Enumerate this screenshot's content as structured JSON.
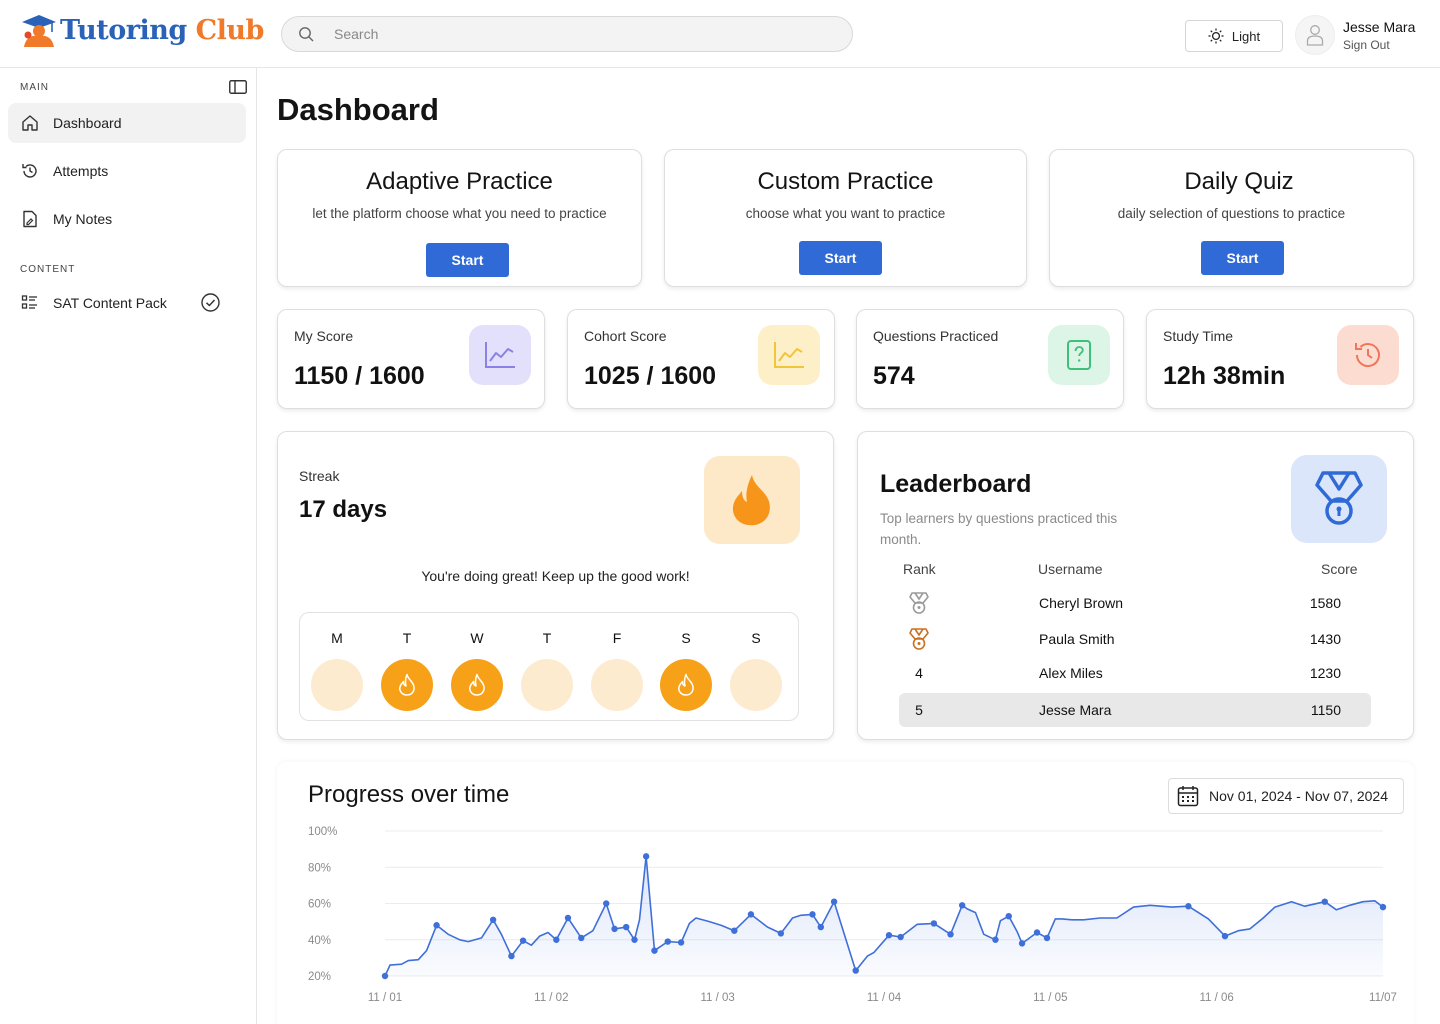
{
  "header": {
    "logo_part1": "Tutoring",
    "logo_part2": "Club",
    "search_placeholder": "Search",
    "theme_label": "Light",
    "user_name": "Jesse Mara",
    "sign_out": "Sign Out"
  },
  "sidebar": {
    "section_main": "MAIN",
    "section_content": "CONTENT",
    "items": [
      {
        "label": "Dashboard",
        "icon": "home-icon"
      },
      {
        "label": "Attempts",
        "icon": "history-icon"
      },
      {
        "label": "My Notes",
        "icon": "notes-icon"
      }
    ],
    "content_items": [
      {
        "label": "SAT Content Pack",
        "icon": "list-icon"
      }
    ]
  },
  "page": {
    "title": "Dashboard"
  },
  "practice": [
    {
      "title": "Adaptive Practice",
      "desc": "let the platform choose what you need to practice",
      "button": "Start"
    },
    {
      "title": "Custom Practice",
      "desc": "choose what you want to practice",
      "button": "Start"
    },
    {
      "title": "Daily Quiz",
      "desc": "daily selection of questions to practice",
      "button": "Start"
    }
  ],
  "stats": [
    {
      "label": "My Score",
      "value": "1150 / 1600",
      "icon": "line-chart-icon",
      "color": "#e3e0fb"
    },
    {
      "label": "Cohort Score",
      "value": "1025 / 1600",
      "icon": "line-chart-icon",
      "color": "#fdf0c8"
    },
    {
      "label": "Questions Practiced",
      "value": "574",
      "icon": "question-card-icon",
      "color": "#dcf5e6"
    },
    {
      "label": "Study Time",
      "value": "12h 38min",
      "icon": "clock-history-icon",
      "color": "#fcdcd1"
    }
  ],
  "streak": {
    "label": "Streak",
    "value": "17 days",
    "message": "You're doing great! Keep up the good work!",
    "days": [
      {
        "letter": "M",
        "active": false
      },
      {
        "letter": "T",
        "active": true
      },
      {
        "letter": "W",
        "active": true
      },
      {
        "letter": "T",
        "active": false
      },
      {
        "letter": "F",
        "active": false
      },
      {
        "letter": "S",
        "active": true
      },
      {
        "letter": "S",
        "active": false
      }
    ]
  },
  "leaderboard": {
    "title": "Leaderboard",
    "subtitle": "Top learners by questions practiced this month.",
    "col_rank": "Rank",
    "col_user": "Username",
    "col_score": "Score",
    "rows": [
      {
        "rank": "",
        "medal": "silver",
        "user": "Cheryl Brown",
        "score": "1580"
      },
      {
        "rank": "",
        "medal": "bronze",
        "user": "Paula Smith",
        "score": "1430"
      },
      {
        "rank": "4",
        "medal": "",
        "user": "Alex Miles",
        "score": "1230"
      },
      {
        "rank": "5",
        "medal": "",
        "user": "Jesse Mara",
        "score": "1150"
      }
    ]
  },
  "progress": {
    "title": "Progress over time",
    "date_range": "Nov 01, 2024 - Nov 07, 2024"
  },
  "chart_data": {
    "type": "area",
    "title": "Progress over time",
    "ylim": [
      20,
      100
    ],
    "yticks": [
      "100%",
      "80%",
      "60%",
      "40%",
      "20%"
    ],
    "ytick_values": [
      100,
      80,
      60,
      40,
      20
    ],
    "xticks": [
      "11 / 01",
      "11 / 02",
      "11 / 03",
      "11 / 04",
      "11 / 05",
      "11 / 06",
      "11/07"
    ],
    "xlim": [
      0,
      6
    ],
    "grid": true,
    "series": [
      {
        "color": "#3f6fd8",
        "x": [
          0.0,
          0.03,
          0.1,
          0.14,
          0.2,
          0.25,
          0.31,
          0.38,
          0.45,
          0.5,
          0.58,
          0.65,
          0.7,
          0.76,
          0.83,
          0.88,
          0.93,
          0.98,
          1.03,
          1.1,
          1.18,
          1.25,
          1.33,
          1.38,
          1.45,
          1.5,
          1.53,
          1.57,
          1.62,
          1.7,
          1.78,
          1.83,
          1.87,
          1.95,
          2.02,
          2.1,
          2.2,
          2.3,
          2.38,
          2.45,
          2.5,
          2.57,
          2.62,
          2.7,
          2.83,
          2.9,
          2.94,
          3.03,
          3.1,
          3.2,
          3.3,
          3.4,
          3.47,
          3.5,
          3.55,
          3.6,
          3.67,
          3.7,
          3.75,
          3.8,
          3.83,
          3.92,
          3.98,
          4.03,
          4.07,
          4.13,
          4.2,
          4.3,
          4.4,
          4.5,
          4.6,
          4.73,
          4.83,
          4.95,
          5.05,
          5.13,
          5.2,
          5.28,
          5.35,
          5.45,
          5.53,
          5.65,
          5.72,
          5.8,
          5.88,
          5.95,
          6.0
        ],
        "y": [
          20,
          26,
          26.5,
          28.5,
          29,
          34,
          48,
          43,
          40,
          39,
          41,
          51,
          43,
          31,
          39.5,
          37,
          42,
          44,
          40,
          52,
          41,
          45,
          60,
          46,
          47,
          40,
          51,
          86,
          34,
          39,
          38.5,
          49,
          52,
          50,
          48,
          45,
          54,
          47,
          43.5,
          52,
          53.5,
          54,
          47,
          61,
          23,
          31,
          33,
          42.5,
          41.5,
          48.5,
          49,
          43,
          59,
          57,
          55,
          43,
          40,
          50.5,
          53,
          44.5,
          38,
          44,
          41,
          51.5,
          51.5,
          51,
          51,
          52,
          52,
          58,
          59,
          58,
          58.5,
          51.5,
          42,
          45,
          46,
          52,
          58,
          61,
          58.5,
          61,
          56.5,
          59,
          61,
          61.5,
          58
        ]
      }
    ]
  }
}
